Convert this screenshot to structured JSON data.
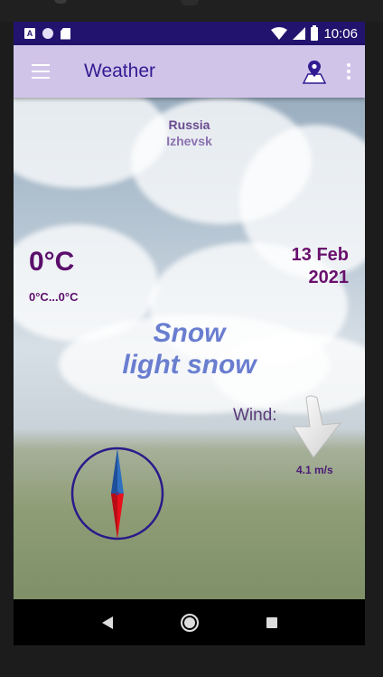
{
  "status_bar": {
    "time": "10:06"
  },
  "app_bar": {
    "title": "Weather"
  },
  "location": {
    "country": "Russia",
    "city": "Izhevsk"
  },
  "temperature": {
    "current": "0°C",
    "range": "0°C...0°C"
  },
  "date": {
    "day_month": "13 Feb",
    "year": "2021"
  },
  "condition": {
    "main": "Snow",
    "description": "light snow"
  },
  "wind": {
    "label": "Wind:",
    "speed": "4.1 m/s"
  },
  "colors": {
    "status_bar": "#22136e",
    "app_bar": "#d1c4e9",
    "title": "#311b92",
    "temperature": "#5b0e6b",
    "condition": "#6a7ed0",
    "compass_ring": "#2a1a8a",
    "compass_north": "#2f6fc0",
    "compass_south": "#e8101a"
  },
  "icons": {
    "menu": "menu-icon",
    "location": "map-pin-icon",
    "more": "more-vert-icon",
    "wind": "wind-direction-arrow-icon",
    "compass": "compass-icon"
  }
}
